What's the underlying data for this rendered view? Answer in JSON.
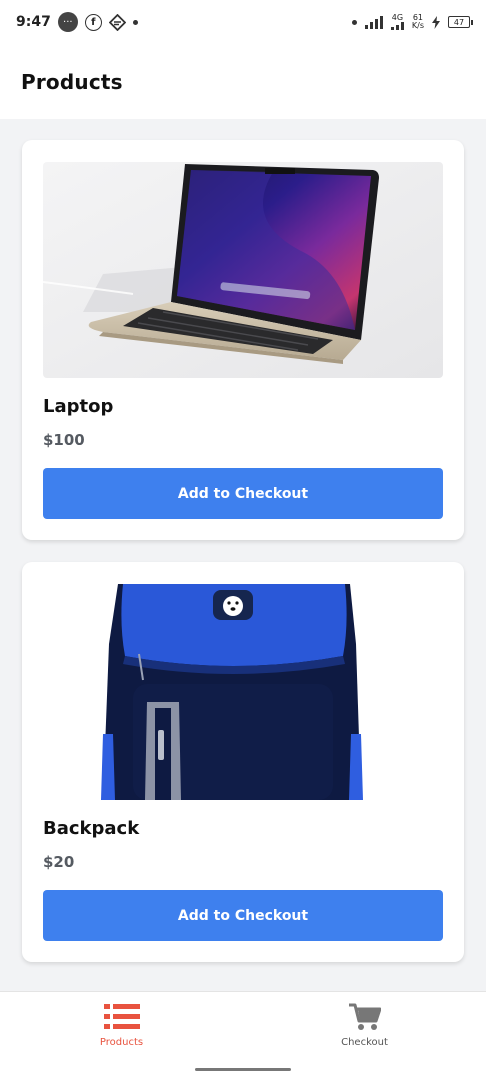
{
  "status_bar": {
    "time": "9:47",
    "bubble_text": "···",
    "network_type": "4G",
    "speed_value": "61",
    "speed_unit": "K/s",
    "battery": "47",
    "icons": [
      "chat-bubble-icon",
      "facebook-icon",
      "feed-icon",
      "signal-icon",
      "charging-icon",
      "battery-icon"
    ]
  },
  "app_bar": {
    "title": "Products"
  },
  "products": [
    {
      "name": "Laptop",
      "price": "$100",
      "button_label": "Add to Checkout",
      "image": "laptop-photo"
    },
    {
      "name": "Backpack",
      "price": "$20",
      "button_label": "Add to Checkout",
      "image": "backpack-photo"
    }
  ],
  "bottom_nav": {
    "items": [
      {
        "label": "Products",
        "icon": "list-icon",
        "active": true
      },
      {
        "label": "Checkout",
        "icon": "cart-icon",
        "active": false
      }
    ]
  },
  "colors": {
    "accent": "#3e80ee",
    "active_tab": "#e8533f",
    "inactive_tab": "#777777",
    "background": "#f2f3f5"
  }
}
